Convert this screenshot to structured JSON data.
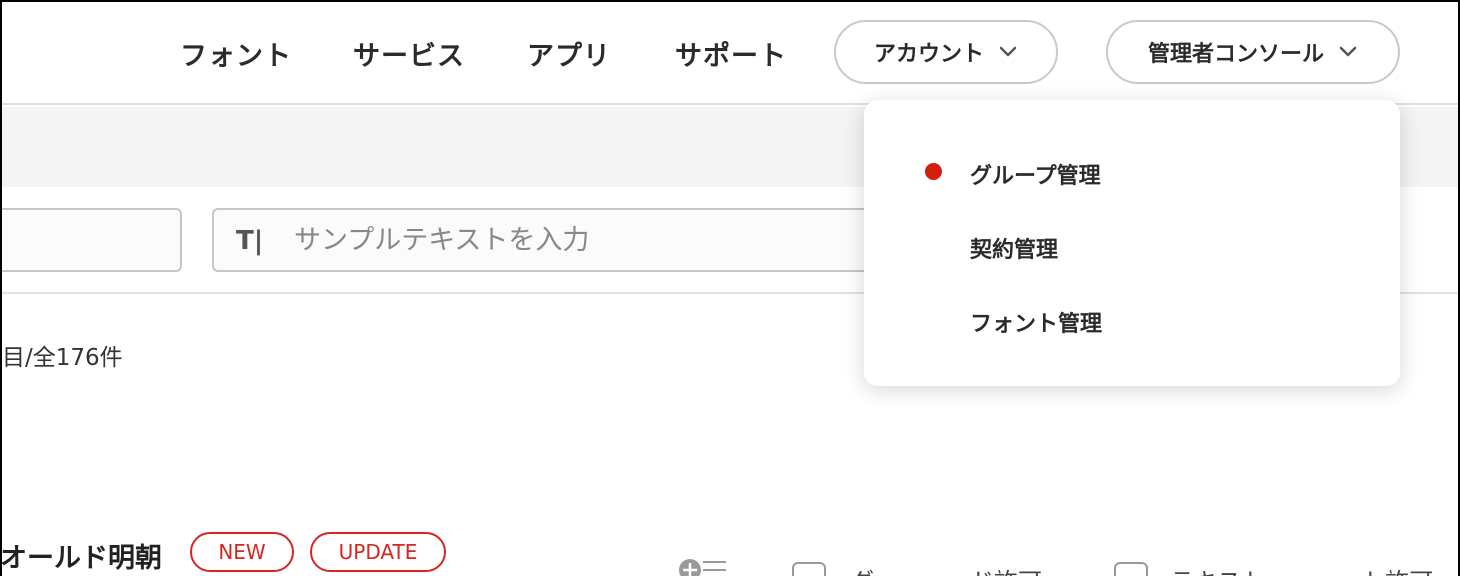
{
  "header": {
    "nav": [
      "フォント",
      "サービス",
      "アプリ",
      "サポート"
    ],
    "account_label": "アカウント",
    "admin_label": "管理者コンソール"
  },
  "search": {
    "sample_icon": "T|",
    "sample_placeholder": "サンプルテキストを入力"
  },
  "results": {
    "count_text": "目/全176件"
  },
  "font_item": {
    "name": "オールド明朝",
    "tags": [
      "NEW",
      "UPDATE"
    ],
    "checkbox_labels": [
      "ダ…………ド許可",
      "テキスト…………ト許可"
    ]
  },
  "admin_menu": {
    "items": [
      {
        "label": "グループ管理",
        "active": true
      },
      {
        "label": "契約管理",
        "active": false
      },
      {
        "label": "フォント管理",
        "active": false
      }
    ],
    "active_color": "#d41f0f"
  },
  "icons": [
    "chevron-down-icon",
    "text-icon",
    "bullet-dot-icon",
    "add-to-list-icon"
  ]
}
